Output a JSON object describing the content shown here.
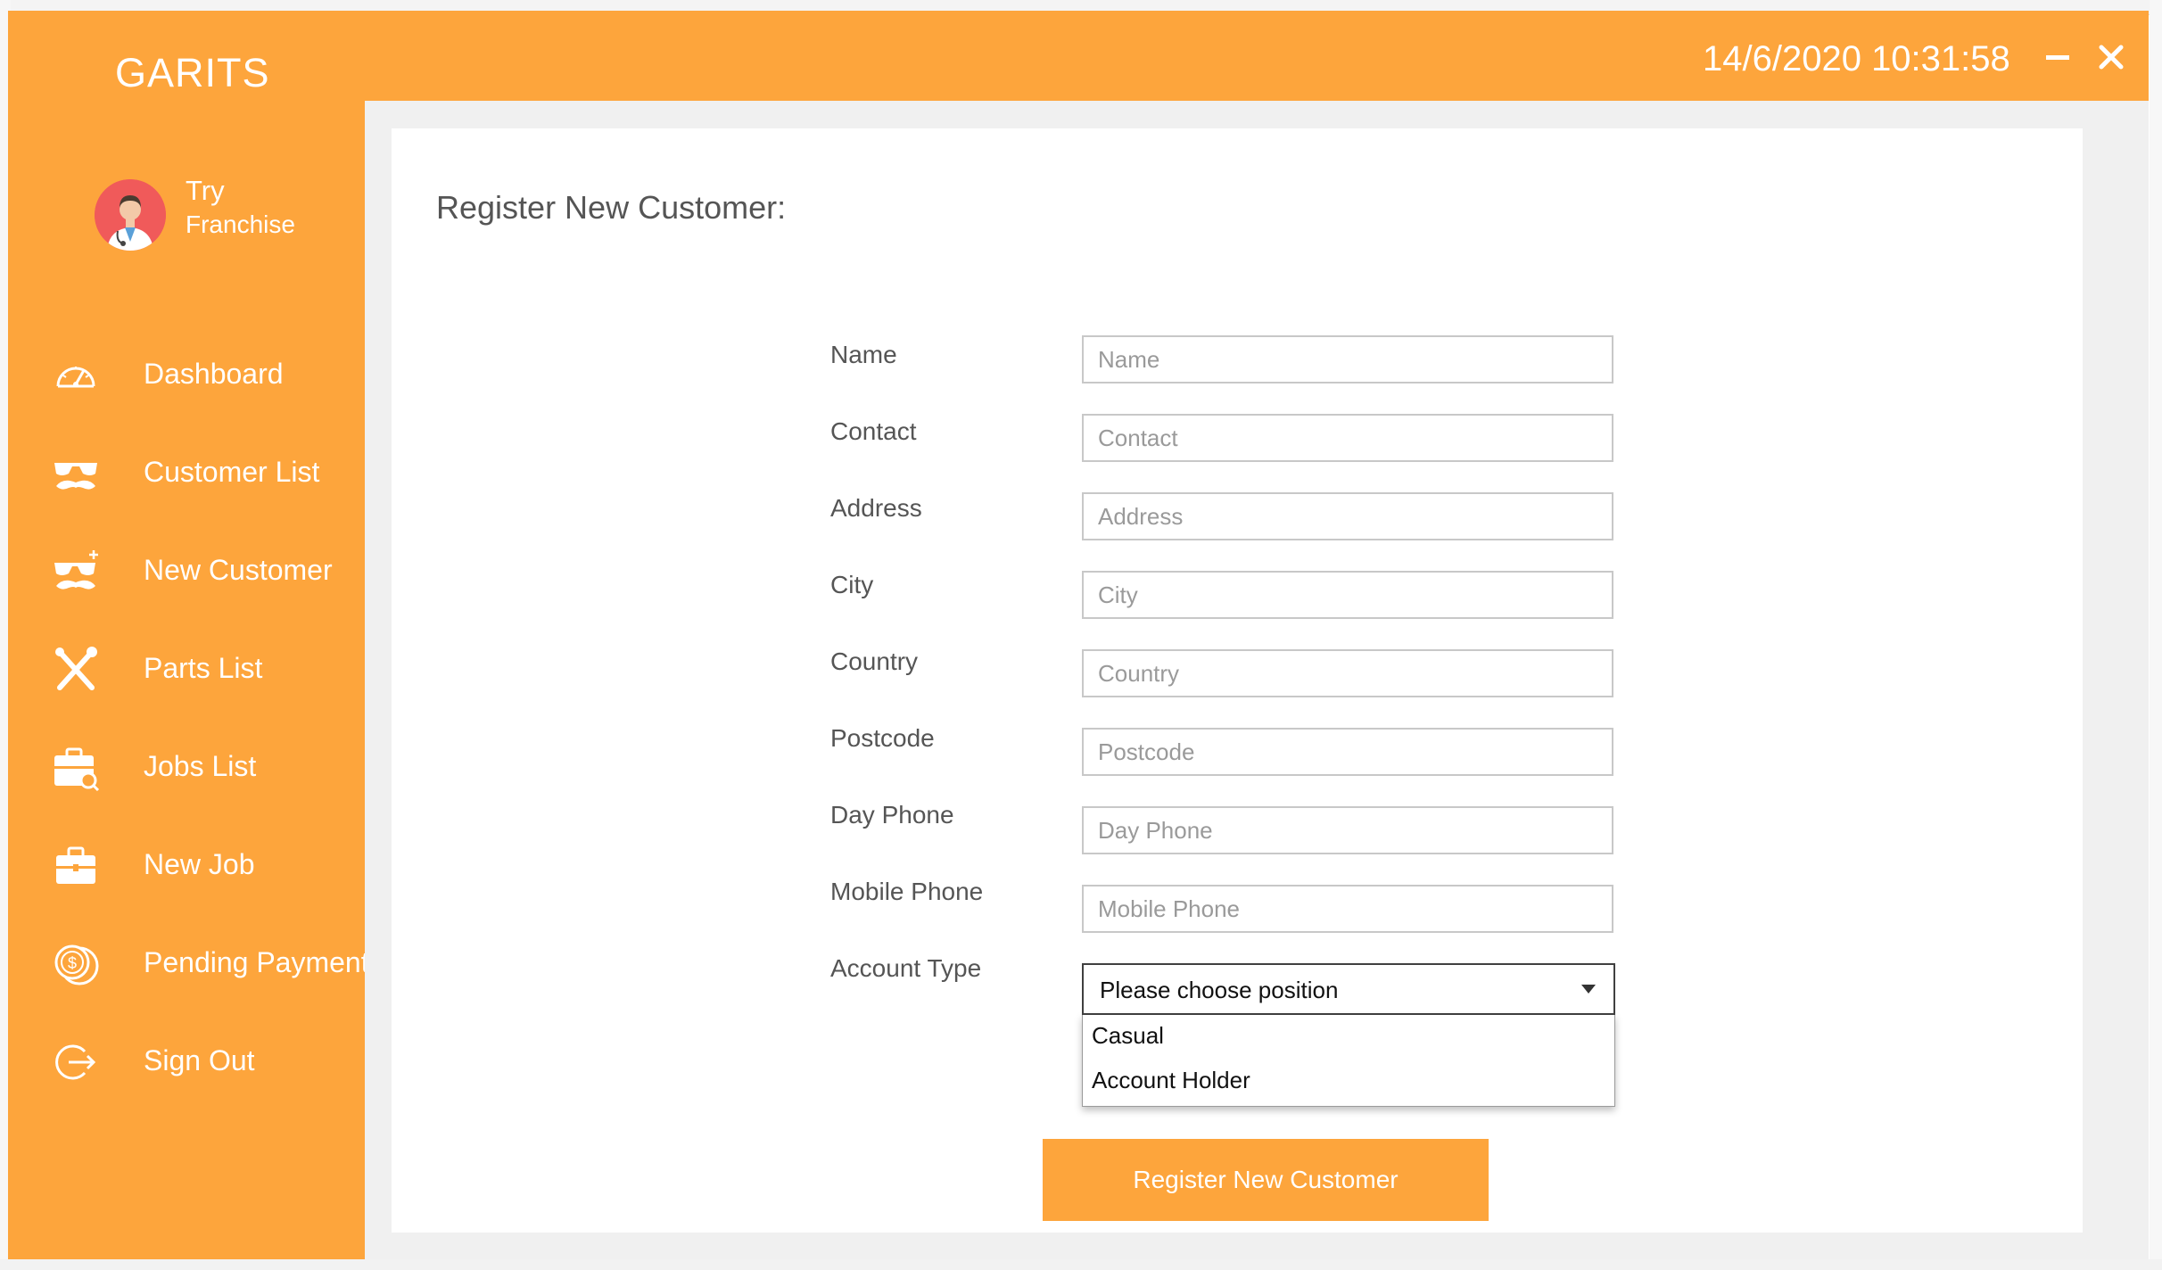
{
  "app": {
    "brand": "GARITS",
    "datetime": "14/6/2020 10:31:58"
  },
  "colors": {
    "accent": "#fda53c",
    "avatar_bg": "#f05a5a",
    "content_bg": "#f0f0f0"
  },
  "window_controls": {
    "minimize_icon": "minimize-icon",
    "close_icon": "close-icon"
  },
  "profile": {
    "name_line1": "Try",
    "name_line2": "Franchise",
    "avatar_icon": "doctor-avatar-icon"
  },
  "sidebar": {
    "items": [
      {
        "label": "Dashboard",
        "icon": "speedometer-icon"
      },
      {
        "label": "Customer List",
        "icon": "mustache-glasses-icon"
      },
      {
        "label": "New Customer",
        "icon": "mustache-glasses-add-icon"
      },
      {
        "label": "Parts List",
        "icon": "wrench-screwdriver-icon"
      },
      {
        "label": "Jobs List",
        "icon": "briefcase-search-icon"
      },
      {
        "label": "New Job",
        "icon": "briefcase-add-icon"
      },
      {
        "label": "Pending Payment",
        "icon": "coins-icon"
      },
      {
        "label": "Sign Out",
        "icon": "sign-out-icon"
      }
    ]
  },
  "form": {
    "title": "Register New Customer:",
    "fields": [
      {
        "label": "Name",
        "placeholder": "Name",
        "value": ""
      },
      {
        "label": "Contact",
        "placeholder": "Contact",
        "value": ""
      },
      {
        "label": "Address",
        "placeholder": "Address",
        "value": ""
      },
      {
        "label": "City",
        "placeholder": "City",
        "value": ""
      },
      {
        "label": "Country",
        "placeholder": "Country",
        "value": ""
      },
      {
        "label": "Postcode",
        "placeholder": "Postcode",
        "value": ""
      },
      {
        "label": "Day Phone",
        "placeholder": "Day Phone",
        "value": ""
      },
      {
        "label": "Mobile Phone",
        "placeholder": "Mobile Phone",
        "value": ""
      }
    ],
    "account_type": {
      "label": "Account Type",
      "selected": "Please choose position",
      "options": [
        "Casual",
        "Account Holder"
      ]
    },
    "submit_label": "Register New Customer"
  }
}
